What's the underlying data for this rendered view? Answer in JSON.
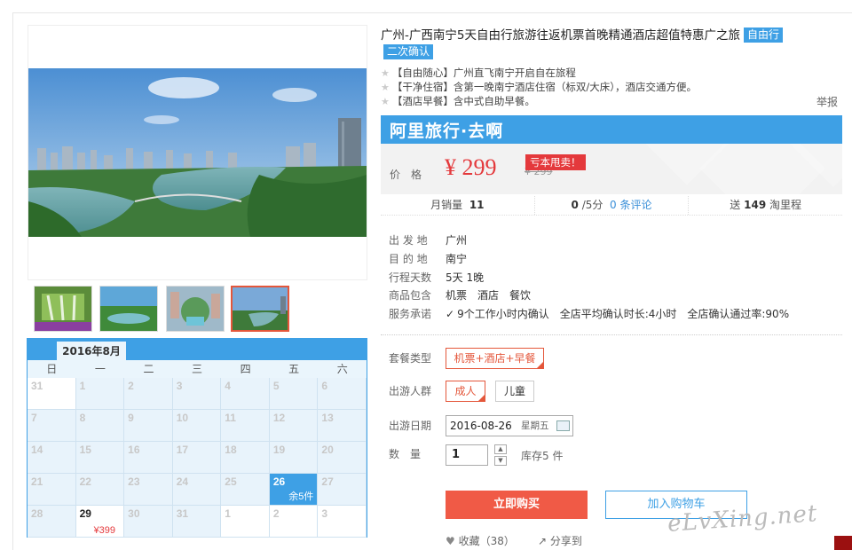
{
  "product": {
    "title": "广州-广西南宁5天自由行旅游往返机票首晚精通酒店超值特惠广之旅",
    "tag_free": "自由行",
    "tag_confirm": "二次确认",
    "features": [
      "【自由随心】广州直飞南宁开启自在旅程",
      "【干净住宿】含第一晚南宁酒店住宿（标双/大床），酒店交通方便。",
      "【酒店早餐】含中式自助早餐。"
    ],
    "report": "举报"
  },
  "brand": {
    "logo": "阿里旅行·去啊",
    "color": "#3ea0e5"
  },
  "price": {
    "label": "价　格",
    "current": "¥ 299",
    "original": "¥ 299",
    "badge": "亏本甩卖！"
  },
  "stats": {
    "sales_label": "月销量",
    "sales": "11",
    "rating": "0",
    "rating_suffix": "/5分",
    "reviews": "0 条评论",
    "points_prefix": "送",
    "points": "149",
    "points_suffix": "淘里程"
  },
  "info": [
    {
      "k": "出 发 地",
      "v": "广州"
    },
    {
      "k": "目 的 地",
      "v": "南宁"
    },
    {
      "k": "行程天数",
      "v": "5天 1晚"
    },
    {
      "k": "商品包含",
      "v": "机票　酒店　餐饮"
    },
    {
      "k": "服务承诺",
      "v": "9个工作小时内确认　全店平均确认时长:4小时　全店确认通过率:90%"
    }
  ],
  "options": {
    "package_label": "套餐类型",
    "package": "机票+酒店+早餐",
    "people_label": "出游人群",
    "adult": "成人",
    "child": "儿童",
    "date_label": "出游日期",
    "date": "2016-08-26",
    "weekday": "星期五",
    "qty_label": "数　量",
    "qty": "1",
    "stock": "库存5 件"
  },
  "actions": {
    "buy": "立即购买",
    "cart": "加入购物车",
    "fav": "收藏（38）",
    "share": "分享到"
  },
  "calendar": {
    "month": "2016年8月",
    "weekdays": [
      "日",
      "一",
      "二",
      "三",
      "四",
      "五",
      "六"
    ],
    "days": [
      "31",
      "1",
      "2",
      "3",
      "4",
      "5",
      "6",
      "7",
      "8",
      "9",
      "10",
      "11",
      "12",
      "13",
      "14",
      "15",
      "16",
      "17",
      "18",
      "19",
      "20",
      "21",
      "22",
      "23",
      "24",
      "25",
      "26",
      "27",
      "28",
      "29",
      "30",
      "31",
      "1",
      "2",
      "3"
    ],
    "sel_day_note": "余5件",
    "day29_price": "¥399"
  },
  "watermark": "eLvXing.net"
}
